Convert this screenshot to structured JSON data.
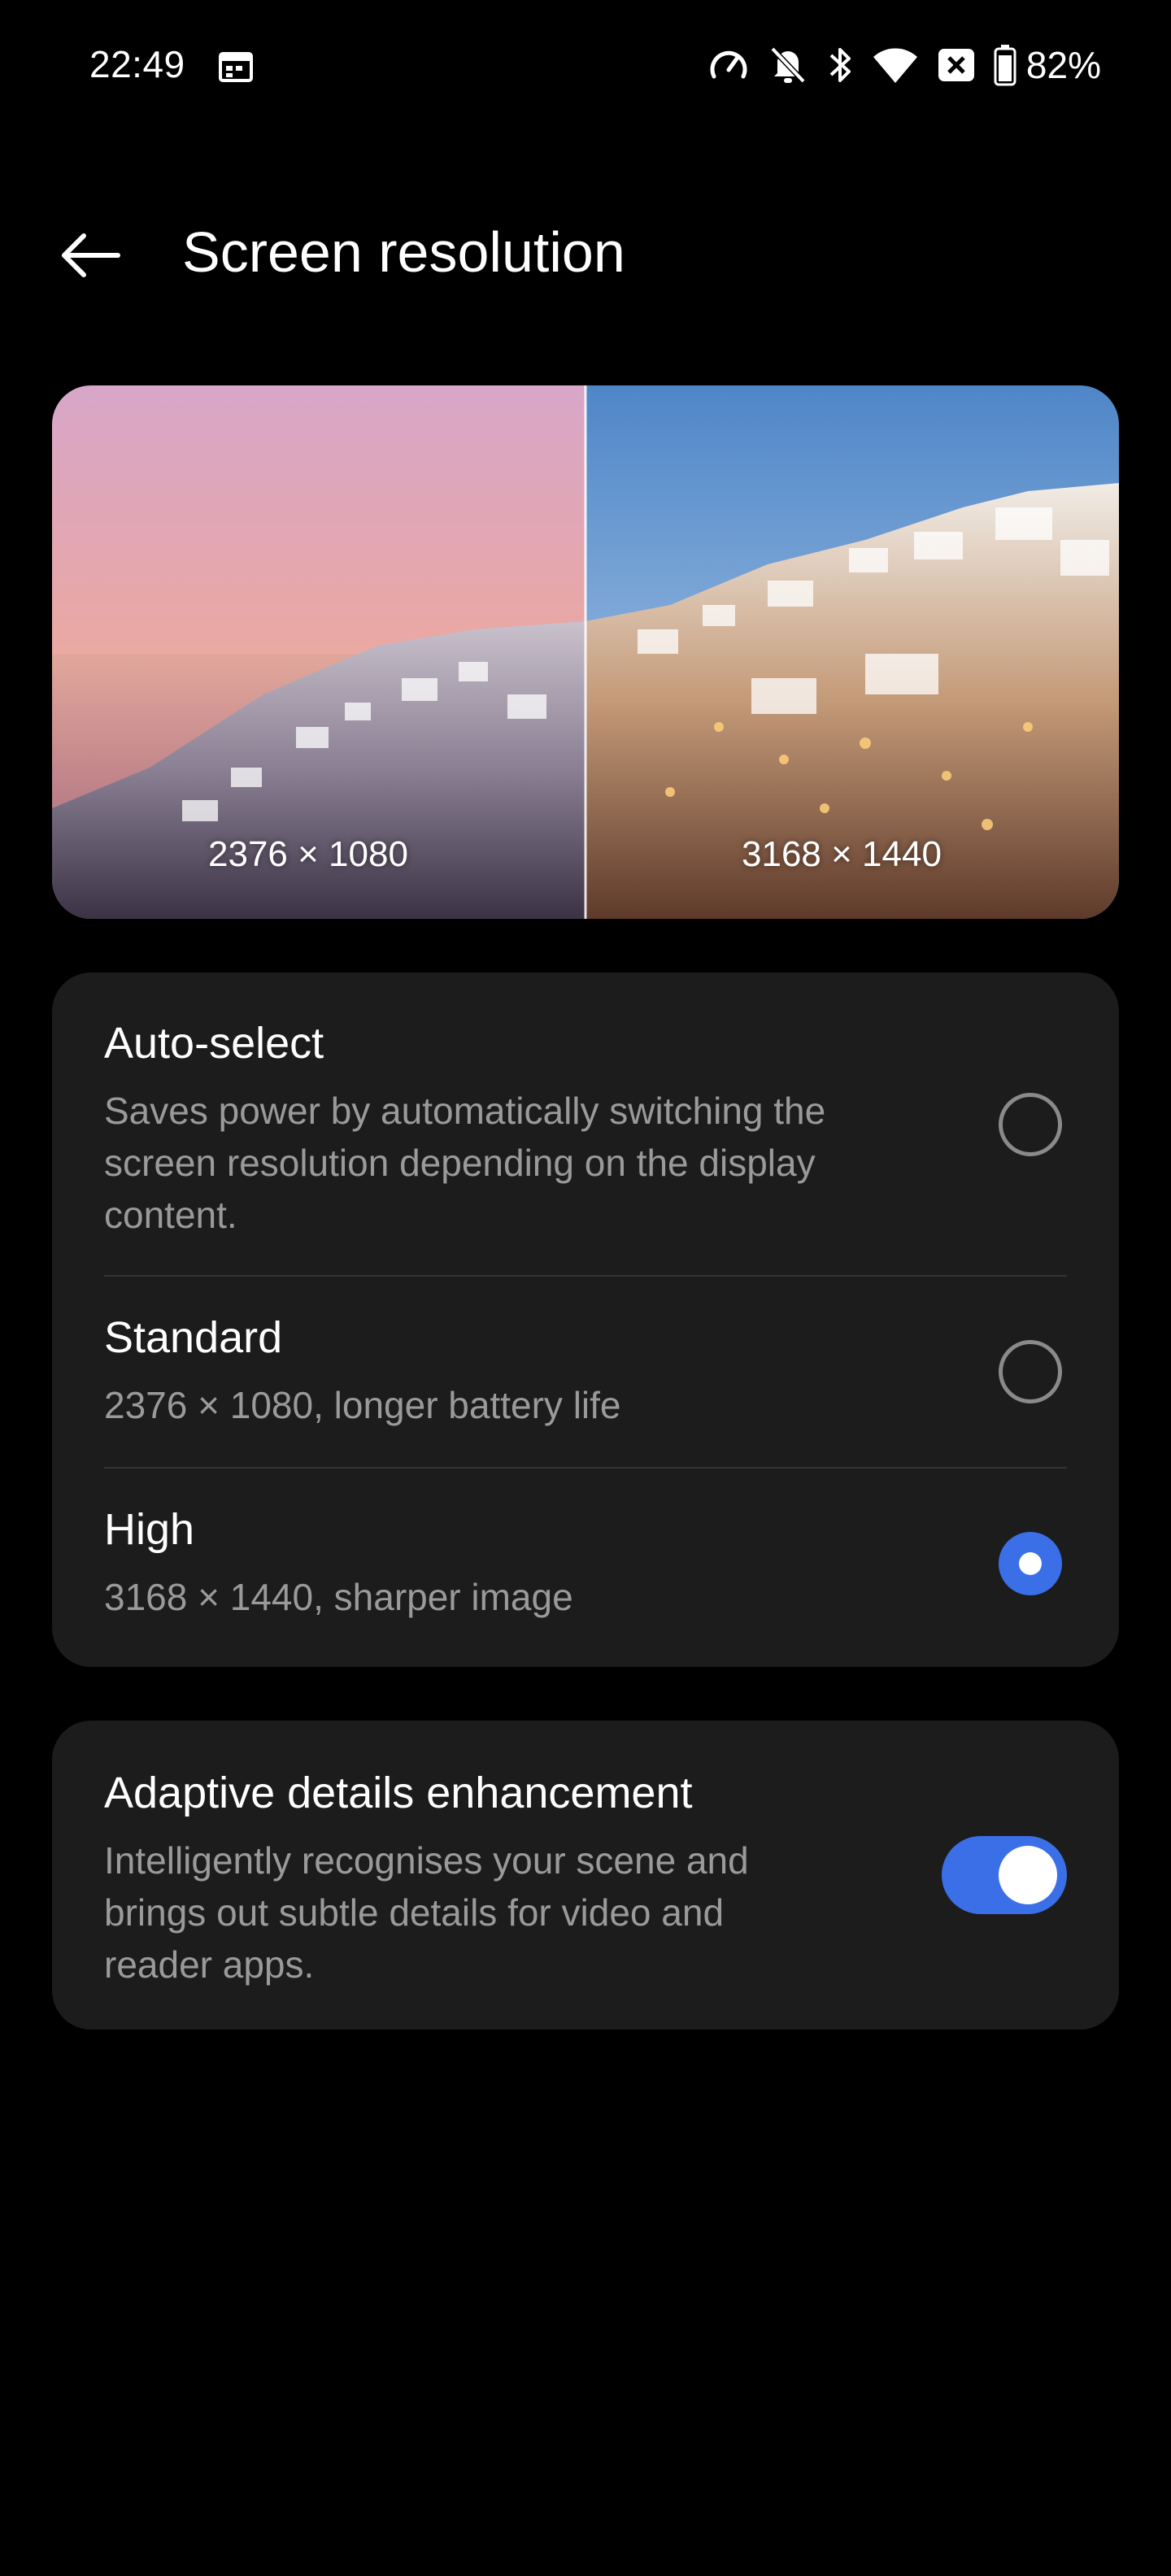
{
  "status_bar": {
    "time": "22:49",
    "battery_percent": "82%",
    "icons": [
      "calendar-icon",
      "speedometer-icon",
      "bell-off-icon",
      "bluetooth-icon",
      "wifi-icon",
      "close-box-icon",
      "battery-icon"
    ]
  },
  "header": {
    "title": "Screen resolution",
    "back_icon": "arrow-left-icon"
  },
  "preview": {
    "left_label": "2376 × 1080",
    "right_label": "3168 × 1440"
  },
  "resolution_options": [
    {
      "title": "Auto-select",
      "description": "Saves power by automatically switching the screen resolution depending on the display content.",
      "selected": false
    },
    {
      "title": "Standard",
      "description": "2376 × 1080, longer battery life",
      "selected": false
    },
    {
      "title": "High",
      "description": "3168 × 1440, sharper image",
      "selected": true
    }
  ],
  "adaptive": {
    "title": "Adaptive details enhancement",
    "description": "Intelligently recognises your scene and brings out subtle details for video and reader apps.",
    "enabled": true
  },
  "colors": {
    "accent": "#3b6fe8",
    "card_background": "#1c1c1c",
    "secondary_text": "#9a9a9a"
  }
}
